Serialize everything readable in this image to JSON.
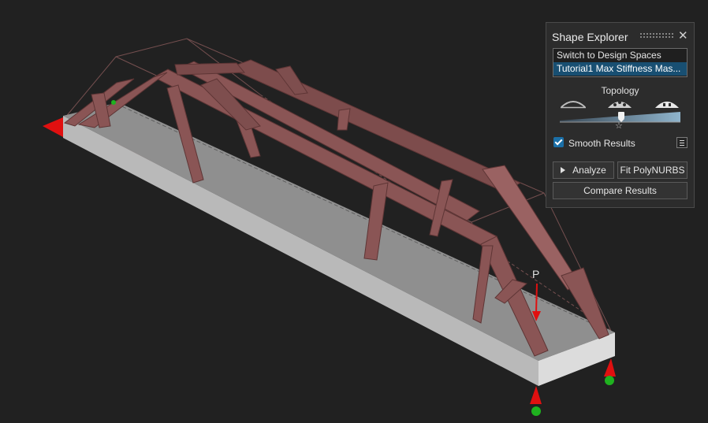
{
  "panel": {
    "title": "Shape Explorer",
    "close_icon": "close-icon",
    "design_spaces": {
      "items": [
        {
          "label": "Switch to Design Spaces",
          "selected": false
        },
        {
          "label": "Tutorial1 Max Stiffness Mas...",
          "selected": true
        }
      ]
    },
    "topology": {
      "label": "Topology",
      "icons": [
        "sparse-shape-icon",
        "medium-shape-icon",
        "dense-shape-icon"
      ],
      "slider_value": 0.5,
      "star_icon": "star-icon"
    },
    "smooth_results": {
      "label": "Smooth Results",
      "checked": true
    },
    "options_icon": "menu-icon",
    "buttons": {
      "analyze": "Analyze",
      "fit_polynurbs": "Fit PolyNURBS",
      "compare": "Compare Results"
    }
  },
  "viewport": {
    "load_label": "P"
  },
  "colors": {
    "background": "#212121",
    "panel": "#2c2c2c",
    "accent": "#1b6fa7",
    "selection": "#184f72",
    "part_shape": "#8a5555",
    "design_space_top": "#8c8c8c",
    "support_red": "#e01010",
    "support_green": "#1fb21f"
  }
}
